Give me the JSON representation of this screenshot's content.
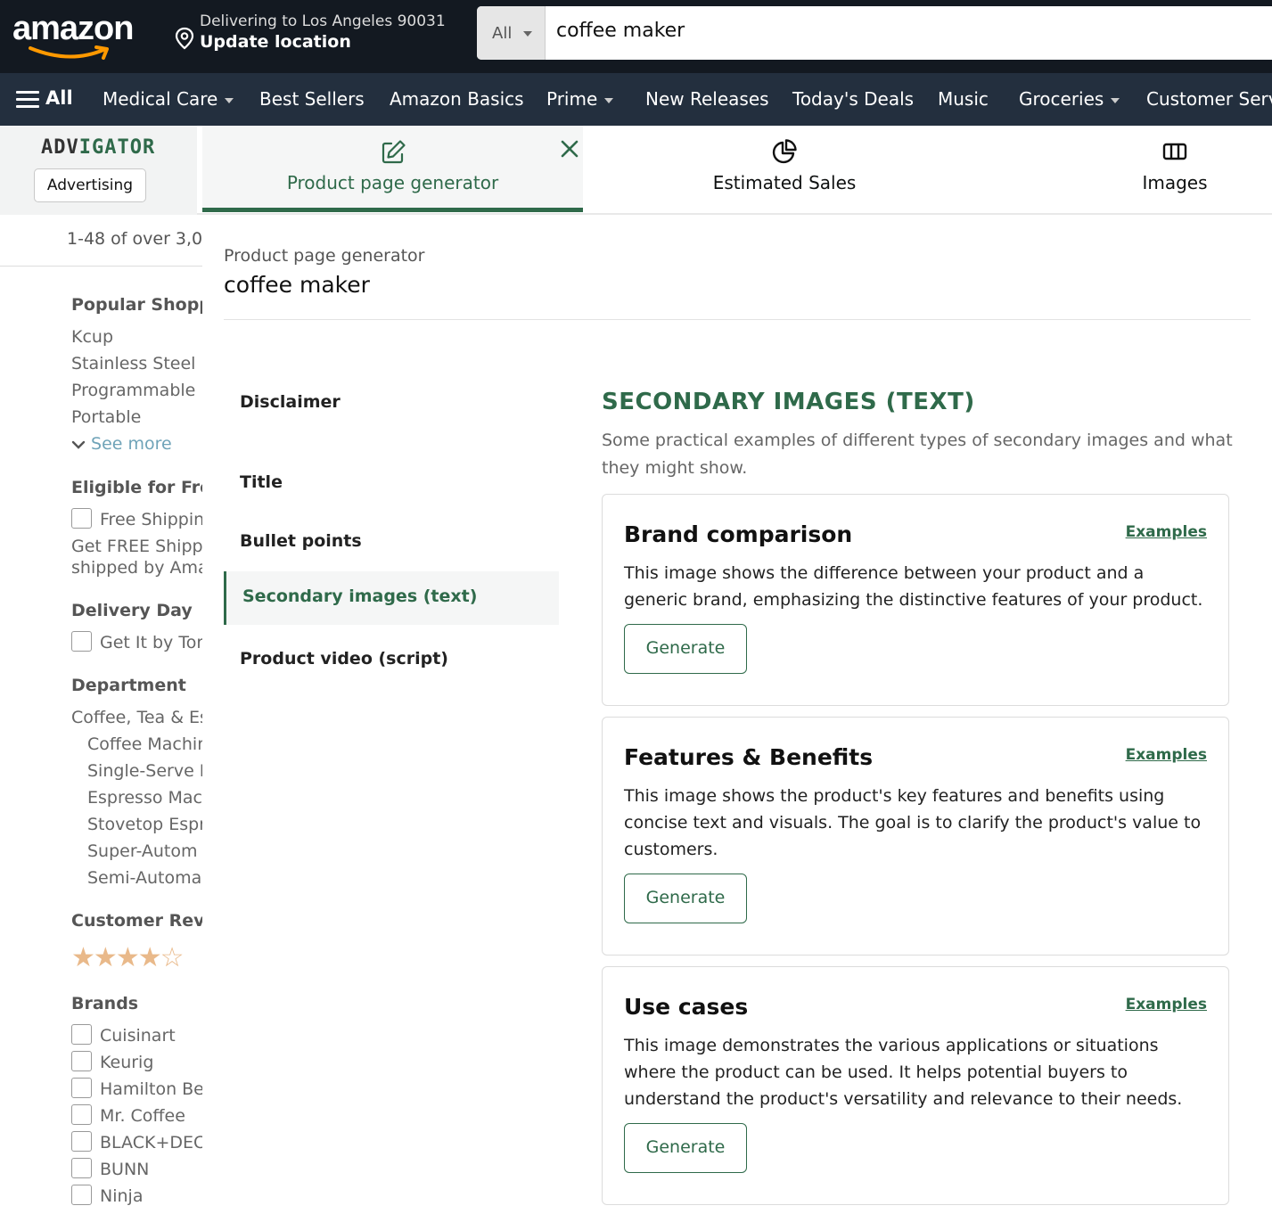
{
  "header": {
    "logo": "amazon",
    "delivery_line1": "Delivering to Los Angeles 90031",
    "delivery_line2": "Update location",
    "search_category": "All",
    "search_query": "coffee maker"
  },
  "nav": {
    "all_label": "All",
    "items": [
      {
        "label": "Medical Care",
        "dropdown": true
      },
      {
        "label": "Best Sellers"
      },
      {
        "label": "Amazon Basics"
      },
      {
        "label": "Prime",
        "dropdown": true
      },
      {
        "label": "New Releases"
      },
      {
        "label": "Today's Deals"
      },
      {
        "label": "Music"
      },
      {
        "label": "Groceries",
        "dropdown": true
      },
      {
        "label": "Customer Serv"
      }
    ]
  },
  "advigator": {
    "logo_a": "ADV",
    "logo_b": "IGATOR",
    "button": "Advertising",
    "tabs": [
      {
        "label": "Product page generator",
        "icon": "edit-icon",
        "active": true
      },
      {
        "label": "Estimated Sales",
        "icon": "pie-chart-icon"
      },
      {
        "label": "Images",
        "icon": "columns-icon"
      }
    ]
  },
  "sidebar": {
    "results": "1-48 of over 3,0",
    "popular_heading": "Popular Shopp",
    "popular_items": [
      "Kcup",
      "Stainless Steel",
      "Programmable",
      "Portable"
    ],
    "see_more": "See more",
    "eligible_heading": "Eligible for Fre",
    "free_shipping": "Free Shippin",
    "free_note_1": "Get FREE Shipp",
    "free_note_2": "shipped by Ama",
    "delivery_heading": "Delivery Day",
    "delivery_option": "Get It by Tor",
    "department_heading": "Department",
    "department_top": "Coffee, Tea & Es",
    "department_items": [
      "Coffee Machir",
      "Single-Serve I",
      "Espresso Macl",
      "Stovetop Espr",
      "Super-Autom",
      "Semi-Automa"
    ],
    "reviews_heading": "Customer Revie",
    "rating": 4,
    "brands_heading": "Brands",
    "brands": [
      "Cuisinart",
      "Keurig",
      "Hamilton Be",
      "Mr. Coffee",
      "BLACK+DEC",
      "BUNN",
      "Ninja"
    ]
  },
  "panel": {
    "breadcrumb": "Product page generator",
    "title": "coffee maker",
    "sections": [
      {
        "label": "Disclaimer"
      },
      {
        "label": "Title"
      },
      {
        "label": "Bullet points"
      },
      {
        "label": "Secondary images (text)",
        "active": true
      },
      {
        "label": "Product video (script)"
      }
    ],
    "section_heading": "SECONDARY IMAGES (TEXT)",
    "section_desc": "Some practical examples of different types of secondary images and what they might show.",
    "examples_label": "Examples",
    "generate_label": "Generate",
    "cards": [
      {
        "title": "Brand comparison",
        "desc": "This image shows the difference between your product and a generic brand, emphasizing the distinctive features of your product."
      },
      {
        "title": "Features & Benefits",
        "desc": "This image shows the product's key features and benefits using concise text and visuals. The goal is to clarify the product's value to customers."
      },
      {
        "title": "Use cases",
        "desc": "This image demonstrates the various applications or situations where the product can be used. It helps potential buyers to understand the product's versatility and relevance to their needs."
      }
    ]
  },
  "colors": {
    "header_bg": "#131921",
    "nav_bg": "#232f3e",
    "accent": "#2f6a4a",
    "smile": "#ff9900"
  }
}
